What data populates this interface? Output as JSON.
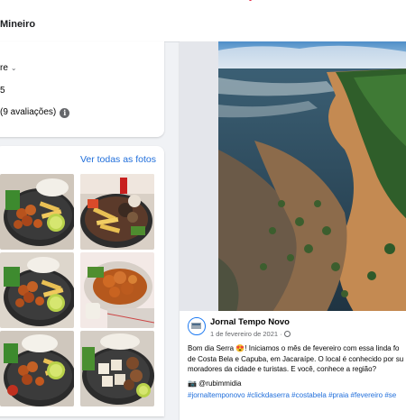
{
  "header": {
    "title": "Mineiro"
  },
  "info_card": {
    "line1": "re",
    "line2": "5",
    "line3": "(9 avaliações)",
    "info_icon": "info-icon"
  },
  "photos_card": {
    "see_all": "Ver todas as fotos"
  },
  "post": {
    "author": "Jornal Tempo Novo",
    "date": "1 de fevereiro de 2021 ·",
    "text_lines": [
      "Bom dia Serra 😍! Iniciamos o mês de fevereiro com essa linda fo",
      "de Costa Bela e Capuba, em Jacaraípe. O local é conhecido por su",
      "moradores da cidade e turistas. E você, conhece a região?"
    ],
    "credit": "📷 @rubimmidia",
    "hashtags": "#jornaltemponovo #clickdaserra #costabela #praia #fevereiro #se"
  },
  "colors": {
    "link": "#216fdb",
    "background": "#f0f2f5",
    "card": "#ffffff"
  }
}
